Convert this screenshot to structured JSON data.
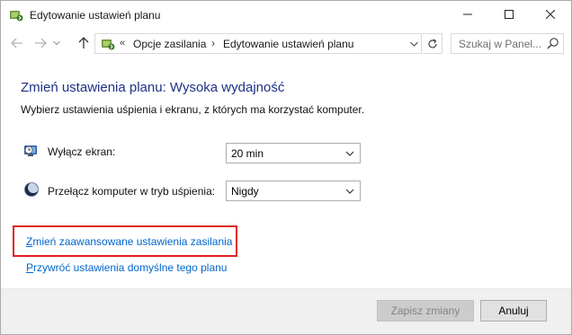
{
  "window": {
    "title": "Edytowanie ustawień planu",
    "controls": {
      "minimize": "minimize",
      "maximize": "maximize",
      "close": "close"
    }
  },
  "nav": {
    "overflow": "«",
    "breadcrumbs": [
      {
        "label": "Opcje zasilania"
      },
      {
        "label": "Edytowanie ustawień planu"
      }
    ],
    "separator": "›",
    "search_placeholder": "Szukaj w Panel..."
  },
  "content": {
    "title": "Zmień ustawienia planu: Wysoka wydajność",
    "subtitle": "Wybierz ustawienia uśpienia i ekranu, z których ma korzystać komputer.",
    "settings": [
      {
        "label": "Wyłącz ekran:",
        "value": "20 min",
        "icon": "monitor-clock-icon"
      },
      {
        "label": "Przełącz komputer w tryb uśpienia:",
        "value": "Nigdy",
        "icon": "moon-icon"
      }
    ],
    "links": {
      "advanced_first": "Z",
      "advanced_rest": "mień zaawansowane ustawienia zasilania",
      "restore_first": "P",
      "restore_rest": "rzywróć ustawienia domyślne tego planu"
    }
  },
  "footer": {
    "save_label": "Zapisz zmiany",
    "cancel_label": "Anuluj"
  },
  "colors": {
    "title": "#1e3287",
    "link": "#0066cc",
    "highlight": "#e02020"
  }
}
